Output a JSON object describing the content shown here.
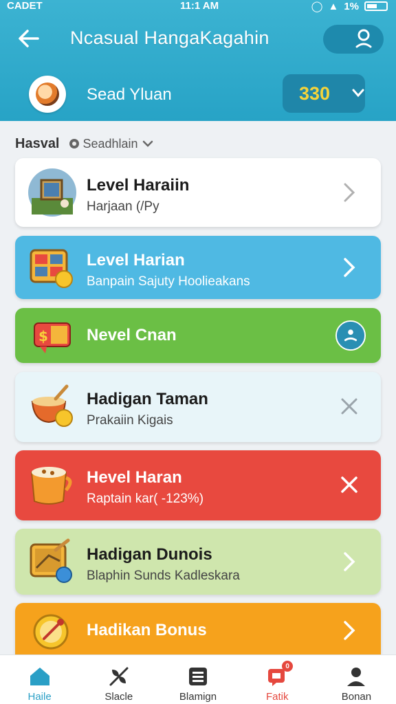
{
  "status_bar": {
    "carrier": "CADET",
    "time": "11:1 AM",
    "battery": "1%"
  },
  "header": {
    "title": "Ncasual HangaKagahin",
    "back_icon": "arrow-left-icon",
    "action_icon": "profile-icon"
  },
  "profile": {
    "name": "Sead Yluan",
    "score": "330"
  },
  "filter": {
    "label": "Hasval",
    "selected": "Seadhlain"
  },
  "cards": [
    {
      "title": "Level Haraiin",
      "subtitle": "Harjaan (/Py",
      "bg": "#ffffff",
      "title_color": "#1b1b1b",
      "subtitle_color": "#444444",
      "action": "chevron-right"
    },
    {
      "title": "Level Harian",
      "subtitle": "Banpain Sajuty Hoolieakans",
      "bg": "#4fb9e3",
      "title_color": "#ffffff",
      "subtitle_color": "#ffffff",
      "action": "chevron-right"
    },
    {
      "title": "Nevel Cnan",
      "subtitle": "",
      "bg": "#6bbf45",
      "title_color": "#ffffff",
      "subtitle_color": "#ffffff",
      "action": "user-circle"
    },
    {
      "title": "Hadigan Taman",
      "subtitle": "Prakaiin Kigais",
      "bg": "#e8f5f9",
      "title_color": "#1b1b1b",
      "subtitle_color": "#444444",
      "action": "close"
    },
    {
      "title": "Hevel Haran",
      "subtitle": "Raptain kar( -123%)",
      "bg": "#e8493f",
      "title_color": "#ffffff",
      "subtitle_color": "#ffffff",
      "action": "close"
    },
    {
      "title": "Hadigan Dunois",
      "subtitle": "Blaphin Sunds Kadleskara",
      "bg": "#cfe6ad",
      "title_color": "#1b1b1b",
      "subtitle_color": "#444444",
      "action": "chevron-right"
    },
    {
      "title": "Hadikan Bonus",
      "subtitle": "",
      "bg": "#f6a21c",
      "title_color": "#ffffff",
      "subtitle_color": "#ffffff",
      "action": "chevron-right"
    }
  ],
  "bottom_nav": [
    {
      "label": "Haile",
      "icon": "home-icon",
      "color": "#2a9fc6"
    },
    {
      "label": "Slacle",
      "icon": "leaf-icon",
      "color": "#333333"
    },
    {
      "label": "Blamign",
      "icon": "list-icon",
      "color": "#333333"
    },
    {
      "label": "Fatik",
      "icon": "chat-icon",
      "color": "#e5483e",
      "badge": "0"
    },
    {
      "label": "Bonan",
      "icon": "user-icon",
      "color": "#333333"
    }
  ]
}
